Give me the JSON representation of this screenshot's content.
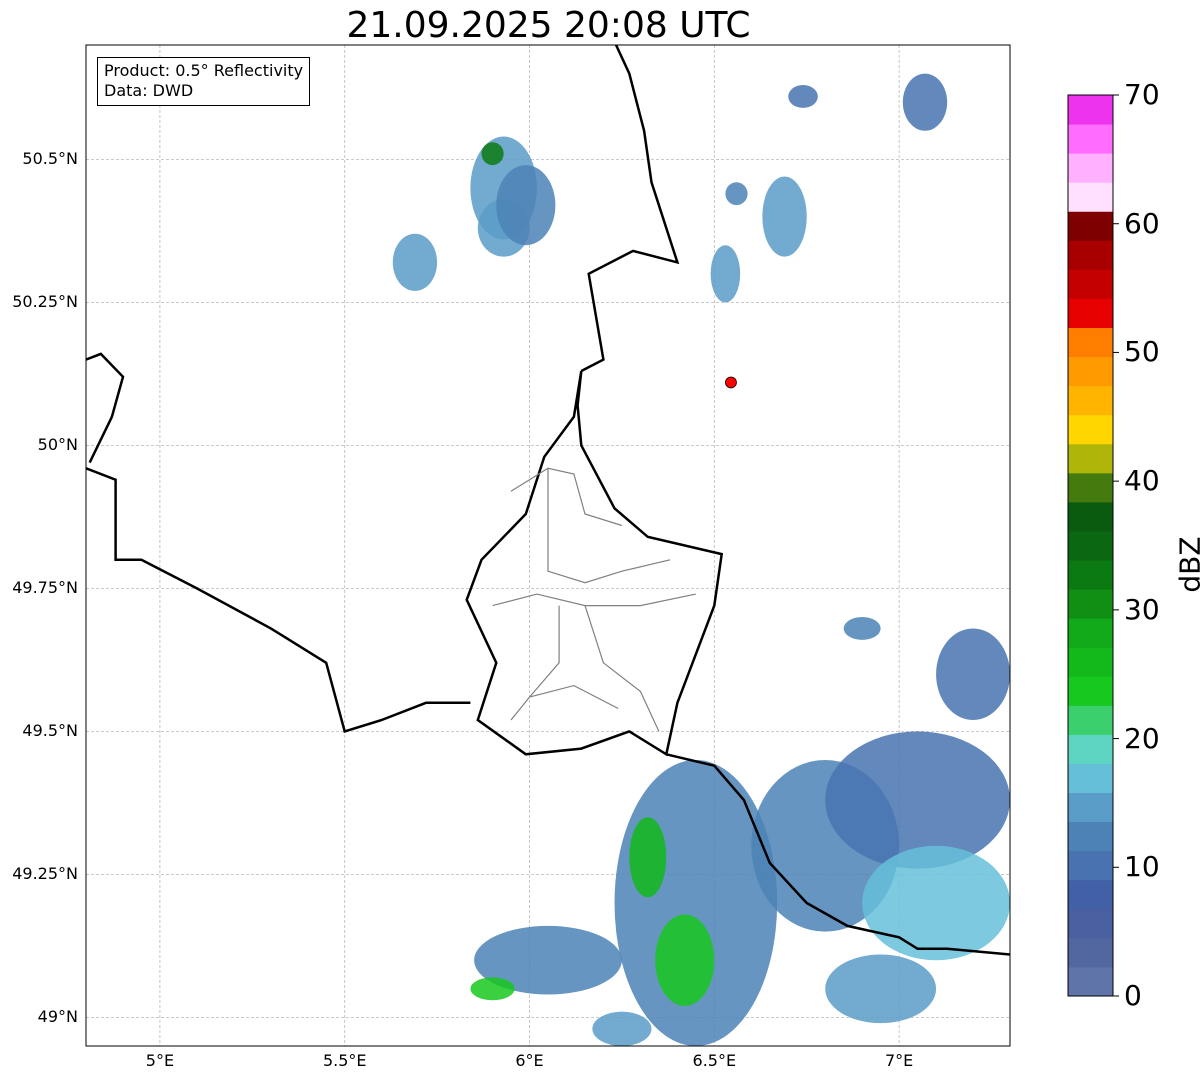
{
  "title": "21.09.2025 20:08 UTC",
  "info": {
    "product": "Product: 0.5° Reflectivity",
    "data": "Data: DWD"
  },
  "axes": {
    "lon_range": [
      4.8,
      7.3
    ],
    "lat_range": [
      48.95,
      50.7
    ],
    "x_ticks": [
      {
        "value": 5.0,
        "label": "5°E"
      },
      {
        "value": 5.5,
        "label": "5.5°E"
      },
      {
        "value": 6.0,
        "label": "6°E"
      },
      {
        "value": 6.5,
        "label": "6.5°E"
      },
      {
        "value": 7.0,
        "label": "7°E"
      }
    ],
    "y_ticks": [
      {
        "value": 50.5,
        "label": "50.5°N"
      },
      {
        "value": 50.25,
        "label": "50.25°N"
      },
      {
        "value": 50.0,
        "label": "50°N"
      },
      {
        "value": 49.75,
        "label": "49.75°N"
      },
      {
        "value": 49.5,
        "label": "49.5°N"
      },
      {
        "value": 49.25,
        "label": "49.25°N"
      },
      {
        "value": 49.0,
        "label": "49°N"
      }
    ],
    "grid": true
  },
  "colorbar": {
    "label": "dBZ",
    "min": 0,
    "max": 70,
    "tick_labels": [
      "0",
      "10",
      "20",
      "30",
      "40",
      "50",
      "60",
      "70"
    ],
    "tick_values": [
      0,
      10,
      20,
      30,
      40,
      50,
      60,
      70
    ],
    "colors": [
      "#5f74a8",
      "#52669f",
      "#4a5fa0",
      "#4260a6",
      "#4873b0",
      "#4c82b6",
      "#5a9cc8",
      "#66bfd9",
      "#5ed4c2",
      "#3ccf6e",
      "#17c81f",
      "#13b91a",
      "#12a91a",
      "#108f14",
      "#0c7a13",
      "#0b6712",
      "#0a5a10",
      "#457a0e",
      "#b0b50a",
      "#ffd600",
      "#ffb400",
      "#ff9a00",
      "#ff7e00",
      "#e60000",
      "#c40000",
      "#a80000",
      "#7e0000",
      "#ffe0ff",
      "#ffb0ff",
      "#ff6cff",
      "#ee33ee"
    ]
  },
  "marker": {
    "name": "site",
    "lon": 6.545,
    "lat": 50.11,
    "color": "#ff0000"
  },
  "borders": {
    "color": "#000000",
    "outline": [
      [
        6.14,
        50.13
      ],
      [
        6.12,
        50.05
      ],
      [
        6.04,
        49.98
      ],
      [
        5.99,
        49.88
      ],
      [
        5.87,
        49.8
      ],
      [
        5.83,
        49.73
      ],
      [
        5.91,
        49.62
      ],
      [
        5.86,
        49.52
      ],
      [
        5.99,
        49.46
      ],
      [
        6.14,
        49.47
      ],
      [
        6.27,
        49.5
      ],
      [
        6.37,
        49.46
      ],
      [
        6.4,
        49.55
      ],
      [
        6.5,
        49.72
      ],
      [
        6.52,
        49.81
      ],
      [
        6.32,
        49.84
      ],
      [
        6.23,
        49.89
      ],
      [
        6.14,
        50.0
      ],
      [
        6.13,
        50.07
      ],
      [
        6.14,
        50.13
      ]
    ],
    "france_belgium": [
      [
        4.8,
        49.96
      ],
      [
        4.88,
        49.94
      ],
      [
        4.88,
        49.8
      ],
      [
        4.95,
        49.8
      ],
      [
        5.1,
        49.75
      ],
      [
        5.3,
        49.68
      ],
      [
        5.45,
        49.62
      ],
      [
        5.5,
        49.5
      ],
      [
        5.6,
        49.52
      ],
      [
        5.72,
        49.55
      ],
      [
        5.84,
        49.55
      ]
    ],
    "belgium_germany": [
      [
        6.14,
        50.13
      ],
      [
        6.2,
        50.15
      ],
      [
        6.16,
        50.3
      ],
      [
        6.28,
        50.34
      ],
      [
        6.4,
        50.32
      ],
      [
        6.33,
        50.46
      ],
      [
        6.31,
        50.55
      ],
      [
        6.27,
        50.65
      ],
      [
        6.22,
        50.72
      ]
    ],
    "france_germany": [
      [
        6.37,
        49.46
      ],
      [
        6.5,
        49.44
      ],
      [
        6.58,
        49.38
      ],
      [
        6.65,
        49.27
      ],
      [
        6.75,
        49.2
      ],
      [
        6.86,
        49.16
      ],
      [
        7.0,
        49.14
      ],
      [
        7.05,
        49.12
      ],
      [
        7.13,
        49.12
      ],
      [
        7.3,
        49.11
      ]
    ],
    "belgium_west": [
      [
        4.8,
        50.15
      ],
      [
        4.84,
        50.16
      ],
      [
        4.9,
        50.12
      ],
      [
        4.87,
        50.05
      ],
      [
        4.81,
        49.97
      ]
    ]
  },
  "precip_cells": [
    {
      "lon": 5.93,
      "lat": 50.45,
      "rx": 0.09,
      "ry": 0.09,
      "level": 6
    },
    {
      "lon": 5.9,
      "lat": 50.51,
      "rx": 0.03,
      "ry": 0.02,
      "level": 14
    },
    {
      "lon": 5.93,
      "lat": 50.38,
      "rx": 0.07,
      "ry": 0.05,
      "level": 6
    },
    {
      "lon": 5.99,
      "lat": 50.42,
      "rx": 0.08,
      "ry": 0.07,
      "level": 5
    },
    {
      "lon": 5.69,
      "lat": 50.32,
      "rx": 0.06,
      "ry": 0.05,
      "level": 6
    },
    {
      "lon": 6.53,
      "lat": 50.3,
      "rx": 0.04,
      "ry": 0.05,
      "level": 6
    },
    {
      "lon": 6.69,
      "lat": 50.4,
      "rx": 0.06,
      "ry": 0.07,
      "level": 6
    },
    {
      "lon": 6.56,
      "lat": 50.44,
      "rx": 0.03,
      "ry": 0.02,
      "level": 5
    },
    {
      "lon": 6.74,
      "lat": 50.61,
      "rx": 0.04,
      "ry": 0.02,
      "level": 4
    },
    {
      "lon": 7.07,
      "lat": 50.6,
      "rx": 0.06,
      "ry": 0.05,
      "level": 4
    },
    {
      "lon": 6.9,
      "lat": 49.68,
      "rx": 0.05,
      "ry": 0.02,
      "level": 5
    },
    {
      "lon": 7.2,
      "lat": 49.6,
      "rx": 0.1,
      "ry": 0.08,
      "level": 4
    },
    {
      "lon": 6.45,
      "lat": 49.2,
      "rx": 0.22,
      "ry": 0.25,
      "level": 5
    },
    {
      "lon": 6.42,
      "lat": 49.1,
      "rx": 0.08,
      "ry": 0.08,
      "level": 10
    },
    {
      "lon": 6.32,
      "lat": 49.28,
      "rx": 0.05,
      "ry": 0.07,
      "level": 11
    },
    {
      "lon": 6.8,
      "lat": 49.3,
      "rx": 0.2,
      "ry": 0.15,
      "level": 5
    },
    {
      "lon": 7.05,
      "lat": 49.38,
      "rx": 0.25,
      "ry": 0.12,
      "level": 4
    },
    {
      "lon": 7.1,
      "lat": 49.2,
      "rx": 0.2,
      "ry": 0.1,
      "level": 7
    },
    {
      "lon": 6.05,
      "lat": 49.1,
      "rx": 0.2,
      "ry": 0.06,
      "level": 5
    },
    {
      "lon": 5.9,
      "lat": 49.05,
      "rx": 0.06,
      "ry": 0.02,
      "level": 10
    },
    {
      "lon": 6.25,
      "lat": 48.98,
      "rx": 0.08,
      "ry": 0.03,
      "level": 6
    },
    {
      "lon": 6.95,
      "lat": 49.05,
      "rx": 0.15,
      "ry": 0.06,
      "level": 6
    }
  ]
}
